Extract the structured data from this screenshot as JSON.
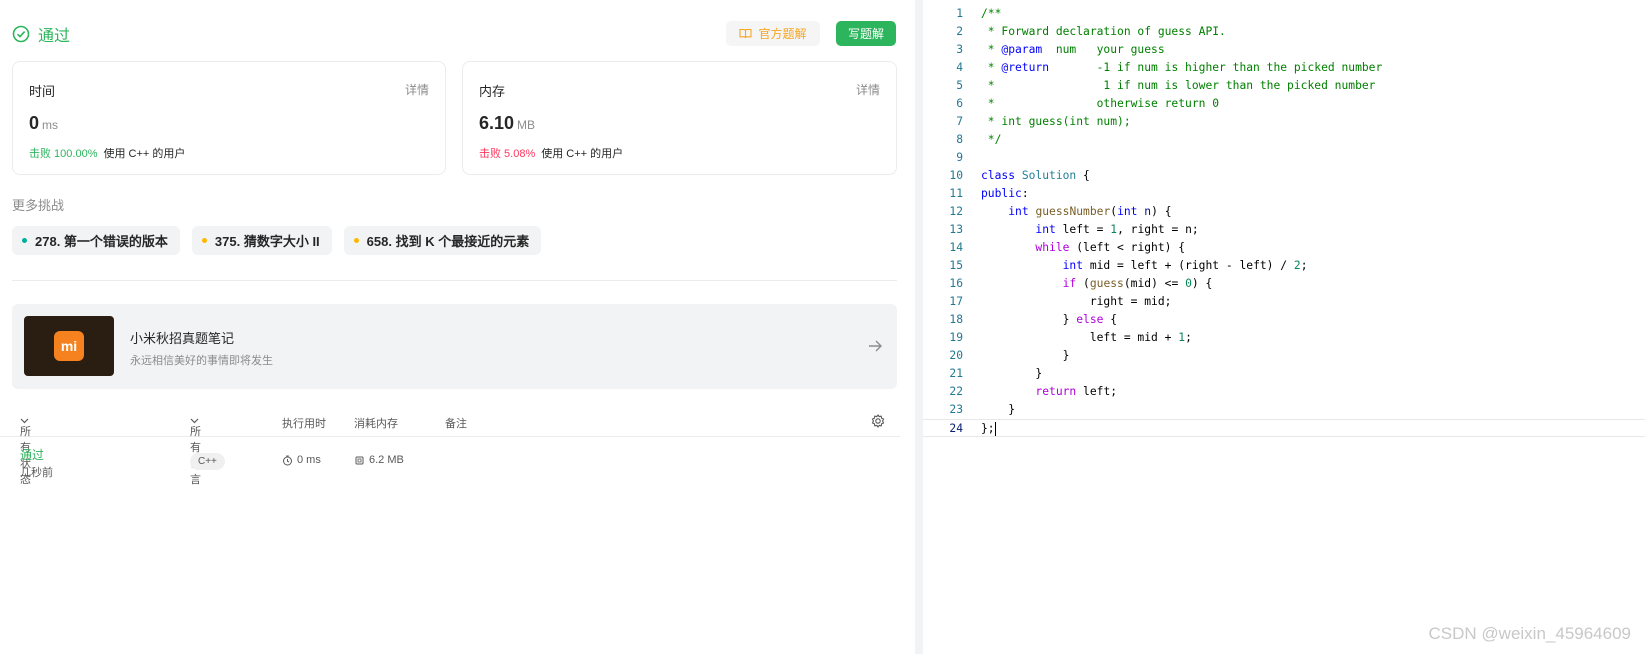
{
  "result": {
    "status": "通过",
    "official_solution_label": "官方题解",
    "write_solution_label": "写题解"
  },
  "time_card": {
    "title": "时间",
    "detail": "详情",
    "value": "0",
    "unit": "ms",
    "beat_text": "击败 100.00%",
    "beat_suffix": "使用 C++ 的用户"
  },
  "memory_card": {
    "title": "内存",
    "detail": "详情",
    "value": "6.10",
    "unit": "MB",
    "beat_text": "击败 5.08%",
    "beat_suffix": "使用 C++ 的用户"
  },
  "more": {
    "title": "更多挑战",
    "items": [
      {
        "label": "278. 第一个错误的版本",
        "color": "#00af9b"
      },
      {
        "label": "375. 猜数字大小 II",
        "color": "#ffb800"
      },
      {
        "label": "658. 找到 K 个最接近的元素",
        "color": "#ffb800"
      }
    ]
  },
  "banner": {
    "logo_text": "mi",
    "title": "小米秋招真题笔记",
    "subtitle": "永远相信美好的事情即将发生"
  },
  "submissions": {
    "headers": {
      "status": "所有状态",
      "language": "所有语言",
      "runtime": "执行用时",
      "memory": "消耗内存",
      "notes": "备注"
    },
    "rows": [
      {
        "status": "通过",
        "time_ago": "几秒前",
        "language": "C++",
        "runtime": "0 ms",
        "memory": "6.2 MB"
      }
    ]
  },
  "editor": {
    "line_numbers": [
      "1",
      "2",
      "3",
      "4",
      "5",
      "6",
      "7",
      "8",
      "9",
      "10",
      "11",
      "12",
      "13",
      "14",
      "15",
      "16",
      "17",
      "18",
      "19",
      "20",
      "21",
      "22",
      "23",
      "24"
    ]
  },
  "watermark": "CSDN @weixin_45964609"
}
